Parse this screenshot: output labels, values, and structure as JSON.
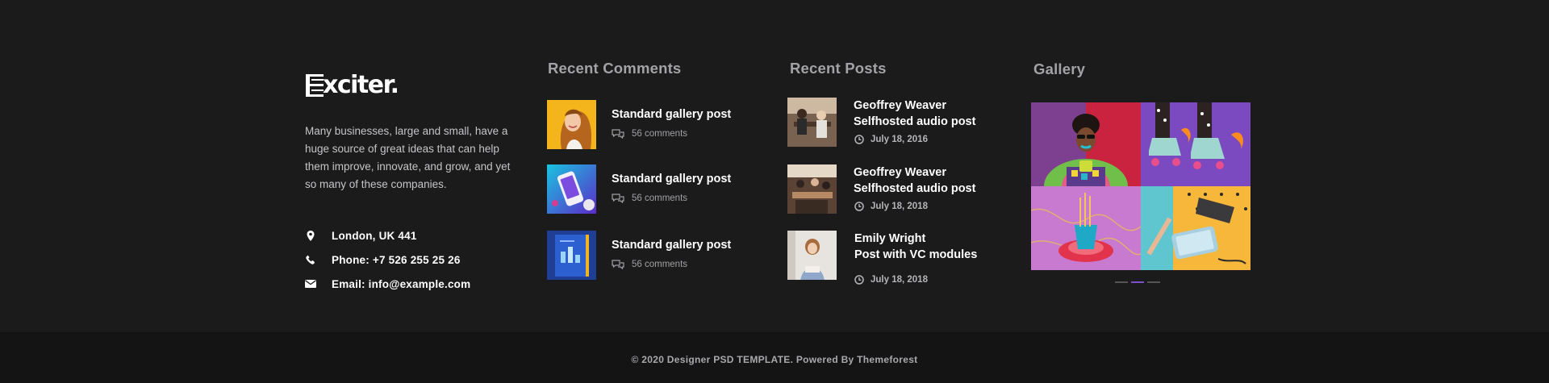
{
  "brand": {
    "name": "xciter",
    "dot": "."
  },
  "about": "Many businesses, large and small, have a huge source of great ideas that can help them improve, innovate, and grow, and yet so many of these companies.",
  "contacts": [
    {
      "icon": "map-pin-icon",
      "text": "London, UK 441"
    },
    {
      "icon": "phone-icon",
      "text": "Phone: +7 526 255 25 26"
    },
    {
      "icon": "envelope-icon",
      "text": "Email: info@example.com"
    }
  ],
  "recent_comments": {
    "title": "Recent Comments",
    "items": [
      {
        "title": "Standard gallery post",
        "meta": "56 comments"
      },
      {
        "title": "Standard gallery post",
        "meta": "56 comments"
      },
      {
        "title": "Standard gallery post",
        "meta": "56 comments"
      }
    ]
  },
  "recent_posts": {
    "title": "Recent Posts",
    "items": [
      {
        "line1": "Geoffrey Weaver",
        "line2": "Selfhosted audio post",
        "date": "July 18, 2016"
      },
      {
        "line1": "Geoffrey Weaver",
        "line2": "Selfhosted audio post",
        "date": "July 18, 2018"
      },
      {
        "line1": "Emily Wright",
        "line2": "Post with VC modules",
        "date": "July 18, 2018"
      }
    ]
  },
  "gallery": {
    "title": "Gallery",
    "active_dot": 2,
    "dot_count": 3
  },
  "copyright": "© 2020 Designer PSD TEMPLATE. Powered By Themeforest",
  "colors": {
    "background": "#1b1b1c",
    "bottom_bar": "#141415",
    "heading": "#a3a3a7",
    "accent": "#7b4fc9"
  }
}
